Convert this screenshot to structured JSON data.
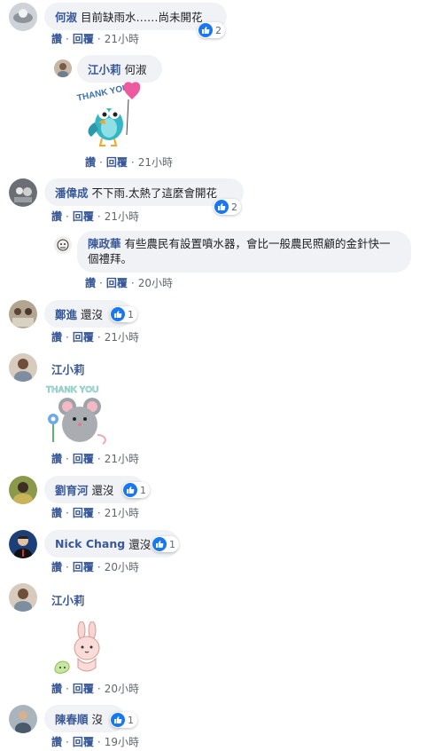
{
  "colors": {
    "link": "#385898",
    "bubble": "#f0f2f5",
    "like": "#1877f2",
    "meta": "#606770"
  },
  "icons": {
    "reaction": "like-icon"
  },
  "actions": {
    "like": "讚",
    "reply": "回覆",
    "sep": "·"
  },
  "comments": [
    {
      "name": "何淑",
      "text": "目前缺雨水……尚未開花",
      "likes": "2",
      "time": "21小時"
    },
    {
      "name": "江小莉",
      "text": "何淑",
      "sticker_text": "THANK YOU!",
      "time": "21小時"
    },
    {
      "name": "潘偉成",
      "text": "不下雨.太熱了這麼會開花",
      "likes": "2",
      "time": "21小時"
    },
    {
      "name": "陳政華",
      "text": "有些農民有設置噴水器，會比一般農民照顧的金針快一個禮拜。",
      "time": "20小時"
    },
    {
      "name": "鄭進",
      "text": "還沒",
      "likes": "1",
      "time": "21小時"
    },
    {
      "name": "江小莉",
      "sticker_text": "THANK YOU",
      "time": "21小時"
    },
    {
      "name": "劉育河",
      "text": "還沒",
      "likes": "1",
      "time": "21小時"
    },
    {
      "name": "Nick Chang",
      "text": "還沒",
      "likes": "1",
      "time": "20小時"
    },
    {
      "name": "江小莉",
      "time": "20小時"
    },
    {
      "name": "陳春順",
      "text": "沒",
      "likes": "1",
      "time": "19小時"
    }
  ]
}
